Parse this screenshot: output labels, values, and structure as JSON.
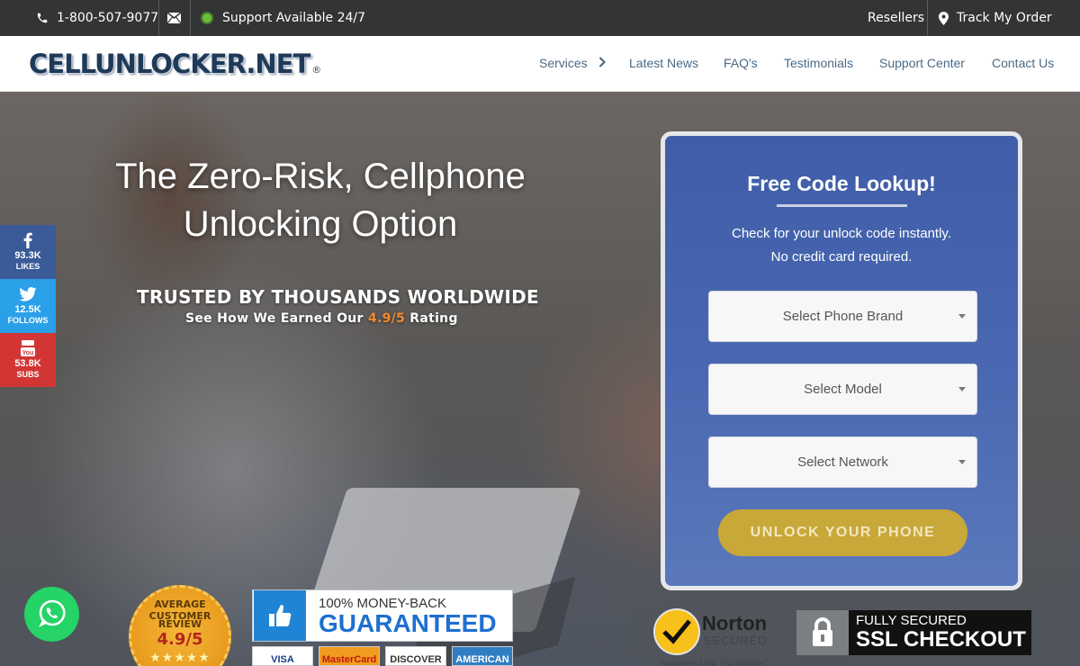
{
  "topbar": {
    "phone": "1-800-507-9077",
    "support": "Support Available 24/7",
    "resellers": "Resellers",
    "track": "Track My Order"
  },
  "nav": {
    "logo": "CELLUNLOCKER.NET",
    "logo_reg": "®",
    "items": [
      "Services",
      "Latest News",
      "FAQ's",
      "Testimonials",
      "Support Center",
      "Contact Us"
    ]
  },
  "hero": {
    "title_line1": "The Zero-Risk, Cellphone",
    "title_line2": "Unlocking Option",
    "trusted": "TRUSTED BY THOUSANDS WORLDWIDE",
    "rating_prefix": "See How We Earned Our ",
    "rating_score": "4.9/5",
    "rating_suffix": " Rating"
  },
  "social": [
    {
      "count": "93.3K",
      "unit": "LIKES",
      "icon": "facebook-icon",
      "color": "#3a5a98"
    },
    {
      "count": "12.5K",
      "unit": "FOLLOWS",
      "icon": "twitter-icon",
      "color": "#2aa0e8"
    },
    {
      "count": "53.8K",
      "unit": "SUBS",
      "icon": "youtube-icon",
      "color": "#d23634"
    }
  ],
  "lookup": {
    "title": "Free Code Lookup!",
    "sub1": "Check for your unlock code instantly.",
    "sub2": "No credit card required.",
    "brand_placeholder": "Select Phone Brand",
    "model_placeholder": "Select Model",
    "network_placeholder": "Select Network",
    "button": "UNLOCK YOUR PHONE"
  },
  "badges": {
    "seal_top": "AVERAGE CUSTOMER",
    "seal_review": "REVIEW",
    "seal_score": "4.9/5",
    "seal_stars": "★★★★★",
    "guarantee_line1": "100% MONEY-BACK",
    "guarantee_line2": "GUARANTEED",
    "cards": [
      "VISA",
      "MasterCard",
      "DISCOVER",
      "AMERICAN"
    ],
    "norton_name": "Norton",
    "norton_secured": "SECURED",
    "norton_powered": "powered by Symantec",
    "ssl_line1": "FULLY SECURED",
    "ssl_line2": "SSL CHECKOUT"
  }
}
